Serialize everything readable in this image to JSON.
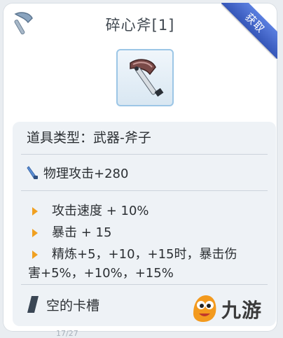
{
  "header": {
    "title": "碎心斧[1]",
    "ribbon_label": "获取"
  },
  "item": {
    "category_icon": "axe-icon",
    "image_icon": "axe-item-icon",
    "type_line": "道具类型：武器-斧子"
  },
  "stats": {
    "attack_icon": "sword-icon",
    "attack": "物理攻击+280"
  },
  "effects": [
    {
      "text": "攻击速度 + 10%"
    },
    {
      "text": "暴击 + 15"
    },
    {
      "line1": "精炼+5，+10，+15时，暴击伤",
      "line2": "害+5%，+10%，+15%"
    }
  ],
  "slot": {
    "icon": "slot-icon",
    "label": "空的卡槽"
  },
  "footer": {
    "partial_number": "17/27"
  },
  "watermark": {
    "brand": "九游"
  },
  "colors": {
    "ribbon": "#3b5fc4",
    "bullet": "#f0a020",
    "item_frame": "#9cc6e6"
  }
}
